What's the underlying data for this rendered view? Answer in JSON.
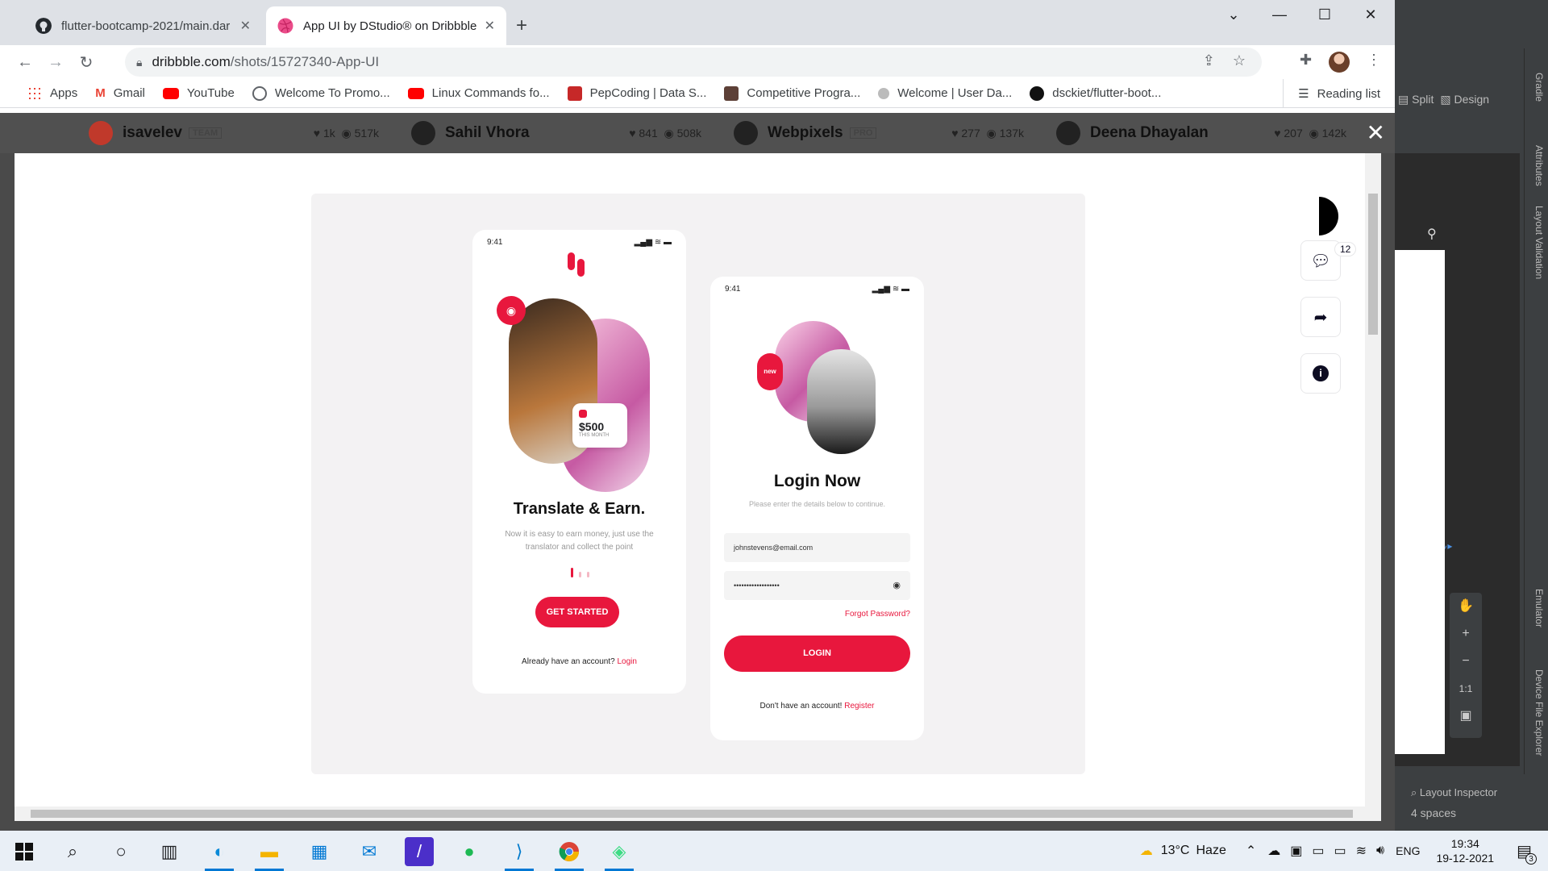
{
  "browser": {
    "tabs": [
      {
        "title": "flutter-bootcamp-2021/main.dar",
        "active": false,
        "icon": "github-icon"
      },
      {
        "title": "App UI by DStudio® on Dribbble",
        "active": true,
        "icon": "dribbble-icon"
      }
    ],
    "url_host": "dribbble.com",
    "url_path": "/shots/15727340-App-UI",
    "bookmarks": [
      {
        "label": "Apps",
        "icon": "apps-grid-icon",
        "color": "#4285f4"
      },
      {
        "label": "Gmail",
        "icon": "gmail-icon",
        "color": "#ea4335"
      },
      {
        "label": "YouTube",
        "icon": "youtube-icon",
        "color": "#ff0000"
      },
      {
        "label": "Welcome To Promo...",
        "icon": "globe-icon",
        "color": "#5f6368"
      },
      {
        "label": "Linux Commands fo...",
        "icon": "youtube-icon",
        "color": "#ff0000"
      },
      {
        "label": "PepCoding | Data S...",
        "icon": "pepcoding-icon",
        "color": "#c62828"
      },
      {
        "label": "Competitive Progra...",
        "icon": "cc-icon",
        "color": "#5d4037"
      },
      {
        "label": "Welcome | User Da...",
        "icon": "user-icon",
        "color": "#888888"
      },
      {
        "label": "dsckiet/flutter-boot...",
        "icon": "github-icon",
        "color": "#111111"
      }
    ],
    "reading_list": "Reading list"
  },
  "behind": {
    "users": [
      {
        "name": "isavelev",
        "badge": "TEAM",
        "likes": "1k",
        "views": "517k"
      },
      {
        "name": "Sahil Vhora",
        "badge": "",
        "likes": "841",
        "views": "508k"
      },
      {
        "name": "Webpixels",
        "badge": "PRO",
        "likes": "277",
        "views": "137k"
      },
      {
        "name": "Deena Dhayalan",
        "badge": "",
        "likes": "207",
        "views": "142k"
      }
    ]
  },
  "side_actions": {
    "comment_count": "12"
  },
  "screen1": {
    "time": "9:41",
    "price": "$500",
    "price_sub": "THIS MONTH",
    "title": "Translate & Earn.",
    "desc_line1": "Now it is easy to earn money, just use the",
    "desc_line2": "translator and collect the point",
    "button": "GET STARTED",
    "footer": "Already have an account?",
    "footer_link": "Login"
  },
  "screen2": {
    "time": "9:41",
    "badge": "new",
    "title": "Login Now",
    "subtitle": "Please enter the details below to continue.",
    "email": "johnstevens@email.com",
    "password": "••••••••••••••••••",
    "forgot": "Forgot Password?",
    "button": "LOGIN",
    "footer": "Don't have an account!",
    "footer_link": "Register"
  },
  "ide": {
    "split": "Split",
    "design": "Design",
    "gradle": "Gradle",
    "attributes": "Attributes",
    "layout_validation": "Layout Validation",
    "emulator": "Emulator",
    "device_explorer": "Device File Explorer",
    "layout_inspector": "Layout Inspector",
    "spaces": "4 spaces",
    "zoom": "1:1"
  },
  "taskbar": {
    "weather_temp": "13°C",
    "weather_desc": "Haze",
    "lang": "ENG",
    "time": "19:34",
    "date": "19-12-2021",
    "notifications": "3"
  },
  "colors": {
    "accent": "#e8173d",
    "dribbble": "#ea4c89"
  }
}
